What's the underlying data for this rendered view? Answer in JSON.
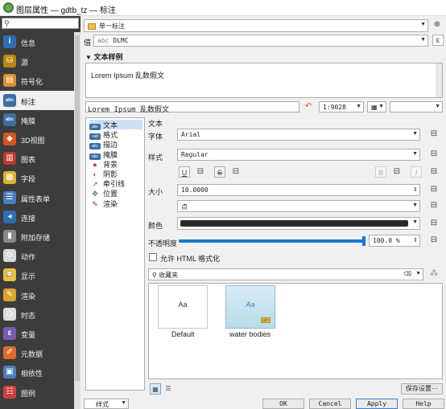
{
  "window": {
    "title": "图层属性 — gdtb_tz — 标注"
  },
  "sidebar": {
    "search_placeholder": "",
    "items": [
      {
        "label": "信息",
        "icon": "info-icon",
        "color": "#2f6db5"
      },
      {
        "label": "源",
        "icon": "source-icon",
        "color": "#b8860b"
      },
      {
        "label": "符号化",
        "icon": "symbology-icon",
        "color": "#e0902e"
      },
      {
        "label": "标注",
        "icon": "labels-icon",
        "color": "#3a6ea5"
      },
      {
        "label": "掩膜",
        "icon": "mask-icon",
        "color": "#3a6ea5"
      },
      {
        "label": "3D视图",
        "icon": "3d-view-icon",
        "color": "#d9541e"
      },
      {
        "label": "图表",
        "icon": "diagrams-icon",
        "color": "#c0392b"
      },
      {
        "label": "字段",
        "icon": "fields-icon",
        "color": "#e0b030"
      },
      {
        "label": "属性表单",
        "icon": "attributes-form-icon",
        "color": "#4a7fc1"
      },
      {
        "label": "连接",
        "icon": "joins-icon",
        "color": "#2f6db5"
      },
      {
        "label": "附加存储",
        "icon": "auxiliary-storage-icon",
        "color": "#888888"
      },
      {
        "label": "动作",
        "icon": "actions-icon",
        "color": "#d8d8d8"
      },
      {
        "label": "显示",
        "icon": "display-icon",
        "color": "#e8c040"
      },
      {
        "label": "渲染",
        "icon": "rendering-icon",
        "color": "#d9a52a"
      },
      {
        "label": "时态",
        "icon": "temporal-icon",
        "color": "#dddddd"
      },
      {
        "label": "变量",
        "icon": "variables-icon",
        "color": "#7a5ab0"
      },
      {
        "label": "元数据",
        "icon": "metadata-icon",
        "color": "#e06a2a"
      },
      {
        "label": "相依性",
        "icon": "dependencies-icon",
        "color": "#4a7fc1"
      },
      {
        "label": "图例",
        "icon": "legend-icon",
        "color": "#d04040"
      }
    ],
    "style_button": "样式"
  },
  "labels_mode": {
    "value": "单一标注"
  },
  "value_field": {
    "label": "值",
    "value": "DLMC",
    "prefix": "abc"
  },
  "text_sample": {
    "header": "文本样例",
    "preview_text": "Lorem Ipsum 乱数假文",
    "input_text": "Lorem Ipsum 乱数假文",
    "scale": "1:9028"
  },
  "subtabs": [
    {
      "label": "文本",
      "icon": "text-icon"
    },
    {
      "label": "格式",
      "icon": "formatting-icon"
    },
    {
      "label": "描边",
      "icon": "buffer-icon"
    },
    {
      "label": "掩膜",
      "icon": "mask-tab-icon"
    },
    {
      "label": "背景",
      "icon": "background-icon"
    },
    {
      "label": "阴影",
      "icon": "shadow-icon"
    },
    {
      "label": "牵引线",
      "icon": "callouts-icon"
    },
    {
      "label": "位置",
      "icon": "placement-icon"
    },
    {
      "label": "渲染",
      "icon": "rendering-tab-icon"
    }
  ],
  "text_panel": {
    "section_title": "文本",
    "font_label": "字体",
    "font_value": "Arial",
    "style_label": "样式",
    "style_value": "Regular",
    "size_label": "大小",
    "size_value": "10.0000",
    "unit_value": "点",
    "color_label": "颜色",
    "color_value": "#2b2b2b",
    "opacity_label": "不透明度",
    "opacity_value": "100.0 %",
    "opacity_fraction": 1.0,
    "html_checkbox_label": "允许 HTML 格式化",
    "favorites_placeholder": "收藏夹",
    "styles": [
      {
        "name": "Default",
        "preview": "Aa"
      },
      {
        "name": "water bodies",
        "preview": "Aa"
      }
    ],
    "save_button": "保存设置···"
  },
  "buttons": {
    "ok": "OK",
    "cancel": "Cancel",
    "apply": "Apply",
    "help": "Help"
  }
}
